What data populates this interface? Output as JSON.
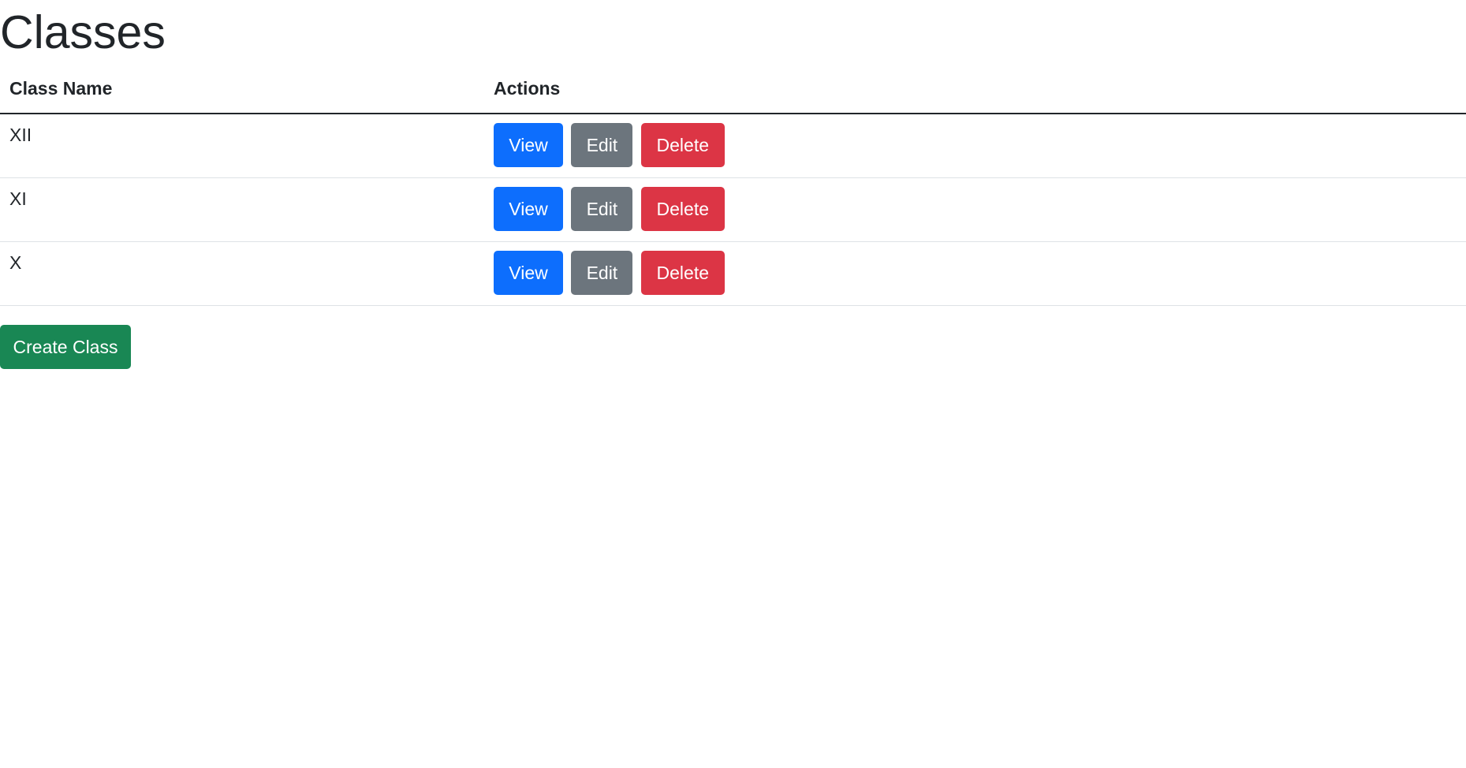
{
  "page": {
    "title": "Classes"
  },
  "table": {
    "columns": [
      "Class Name",
      "Actions"
    ],
    "rows": [
      {
        "name": "XII",
        "view": "View",
        "edit": "Edit",
        "delete": "Delete"
      },
      {
        "name": "XI",
        "view": "View",
        "edit": "Edit",
        "delete": "Delete"
      },
      {
        "name": "X",
        "view": "View",
        "edit": "Edit",
        "delete": "Delete"
      }
    ]
  },
  "actions": {
    "create_label": "Create Class"
  },
  "colors": {
    "primary": "#0d6efd",
    "secondary": "#6c757d",
    "danger": "#dc3545",
    "success": "#198754",
    "text": "#212529"
  }
}
